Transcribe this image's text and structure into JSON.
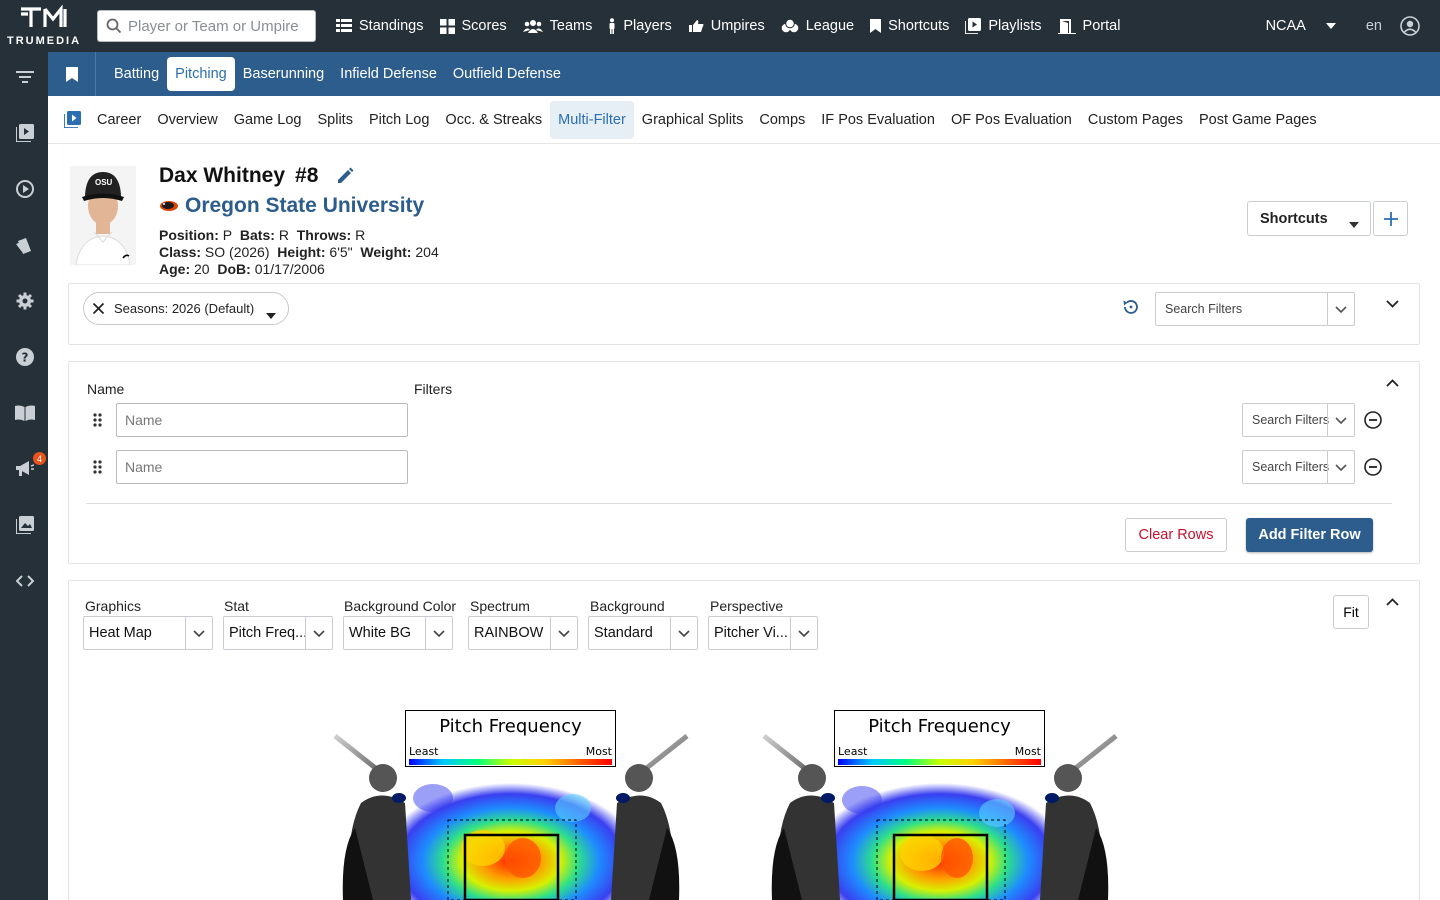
{
  "brand": {
    "logo_text": "TRUMEDIA"
  },
  "search": {
    "placeholder": "Player or Team or Umpire"
  },
  "topnav": [
    {
      "label": "Standings",
      "icon": "table-icon"
    },
    {
      "label": "Scores",
      "icon": "grid-icon"
    },
    {
      "label": "Teams",
      "icon": "users-icon"
    },
    {
      "label": "Players",
      "icon": "person-icon"
    },
    {
      "label": "Umpires",
      "icon": "thumbs-icon"
    },
    {
      "label": "League",
      "icon": "baseball-icon"
    },
    {
      "label": "Shortcuts",
      "icon": "bookmark-icon"
    },
    {
      "label": "Playlists",
      "icon": "playlist-icon"
    },
    {
      "label": "Portal",
      "icon": "portal-icon"
    }
  ],
  "topright": {
    "league": "NCAA",
    "language": "en"
  },
  "sidebar": {
    "notification_count": "4"
  },
  "bluetabs": [
    {
      "label": "Batting",
      "active": false
    },
    {
      "label": "Pitching",
      "active": true
    },
    {
      "label": "Baserunning",
      "active": false
    },
    {
      "label": "Infield Defense",
      "active": false
    },
    {
      "label": "Outfield Defense",
      "active": false
    }
  ],
  "subtabs": [
    {
      "label": "Career",
      "active": false
    },
    {
      "label": "Overview",
      "active": false
    },
    {
      "label": "Game Log",
      "active": false
    },
    {
      "label": "Splits",
      "active": false
    },
    {
      "label": "Pitch Log",
      "active": false
    },
    {
      "label": "Occ. & Streaks",
      "active": false
    },
    {
      "label": "Multi-Filter",
      "active": true
    },
    {
      "label": "Graphical Splits",
      "active": false
    },
    {
      "label": "Comps",
      "active": false
    },
    {
      "label": "IF Pos Evaluation",
      "active": false
    },
    {
      "label": "OF Pos Evaluation",
      "active": false
    },
    {
      "label": "Custom Pages",
      "active": false
    },
    {
      "label": "Post Game Pages",
      "active": false
    }
  ],
  "player": {
    "name": "Dax Whitney",
    "number": "#8",
    "school": "Oregon State University",
    "position_label": "Position:",
    "position": "P",
    "bats_label": "Bats:",
    "bats": "R",
    "throws_label": "Throws:",
    "throws": "R",
    "class_label": "Class:",
    "class": "SO (2026)",
    "height_label": "Height:",
    "height": "6'5\"",
    "weight_label": "Weight:",
    "weight": "204",
    "age_label": "Age:",
    "age": "20",
    "dob_label": "DoB:",
    "dob": "01/17/2006",
    "cap_text": "OSU"
  },
  "header_actions": {
    "shortcuts_label": "Shortcuts"
  },
  "season_filter": {
    "chip_label": "Seasons: 2026 (Default)",
    "search_placeholder": "Search Filters"
  },
  "filter_rows": {
    "name_header": "Name",
    "filters_header": "Filters",
    "rows": [
      {
        "name_placeholder": "Name",
        "filter_placeholder": "Search Filters"
      },
      {
        "name_placeholder": "Name",
        "filter_placeholder": "Search Filters"
      }
    ],
    "clear_label": "Clear Rows",
    "add_label": "Add Filter Row"
  },
  "graphics_controls": {
    "graphics": {
      "label": "Graphics",
      "value": "Heat Map"
    },
    "stat": {
      "label": "Stat",
      "value": "Pitch Freq..."
    },
    "background_color": {
      "label": "Background Color",
      "value": "White BG"
    },
    "spectrum": {
      "label": "Spectrum",
      "value": "RAINBOW"
    },
    "background": {
      "label": "Background",
      "value": "Standard"
    },
    "perspective": {
      "label": "Perspective",
      "value": "Pitcher Vi..."
    },
    "fit_label": "Fit"
  },
  "heatmaps": [
    {
      "title": "Pitch Frequency",
      "least": "Least",
      "most": "Most"
    },
    {
      "title": "Pitch Frequency",
      "least": "Least",
      "most": "Most"
    }
  ],
  "colors": {
    "topbar": "#253039",
    "tabbar": "#2c5d8c",
    "accent": "#2c6fb0",
    "danger": "#c8102e"
  }
}
